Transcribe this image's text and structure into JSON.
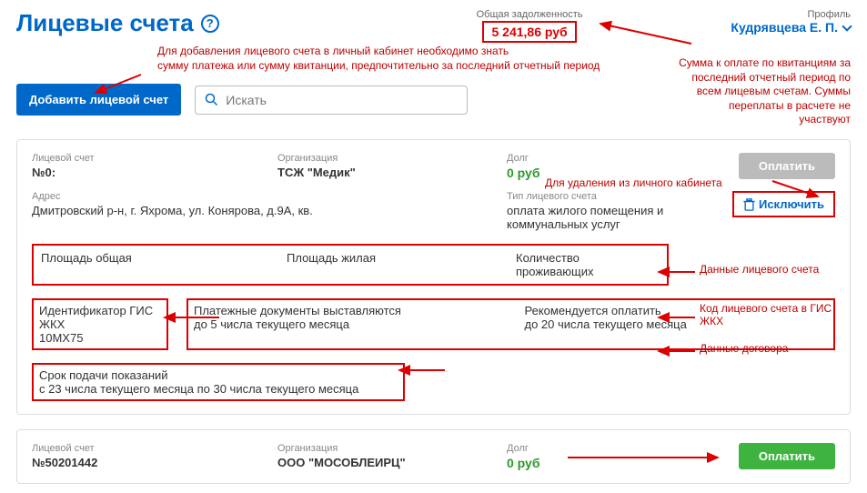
{
  "header": {
    "title": "Лицевые счета",
    "debt_label": "Общая задолженность",
    "debt_value": "5 241,86 руб",
    "profile_label": "Профиль",
    "profile_name": "Кудрявцева Е. П."
  },
  "hints": {
    "add_hint": "Для добавления лицевого счета в личный кабинет необходимо знать\nсумму платежа или сумму квитанции, предпочтительно за последний отчетный период",
    "debt_hint": "Сумма к оплате по квитанциям за последний отчетный период по всем лицевым счетам. Суммы переплаты в расчете не участвуют",
    "delete_hint": "Для удаления из личного кабинета",
    "data_hint": "Данные лицевого счета",
    "gis_hint": "Код лицевого счета в ГИС ЖКХ",
    "contract_hint": "Данные договора"
  },
  "actions": {
    "add_button": "Добавить лицевой счет",
    "search_placeholder": "Искать"
  },
  "account1": {
    "acc_label": "Лицевой счет",
    "acc_value": "№0:",
    "org_label": "Организация",
    "org_value": "ТСЖ \"Медик\"",
    "debt_label": "Долг",
    "debt_value": "0 руб",
    "pay_button": "Оплатить",
    "addr_label": "Адрес",
    "addr_value": "Дмитровский р-н, г. Яхрома, ул. Конярова, д.9А, кв.",
    "type_label": "Тип лицевого счета",
    "type_value": "оплата жилого помещения и коммунальных услуг",
    "exclude_button": "Исключить",
    "area_total_label": "Площадь общая",
    "area_live_label": "Площадь жилая",
    "residents_label": "Количество проживающих",
    "gis_label": "Идентификатор ГИС ЖКХ",
    "gis_value": "10МХ75",
    "docs_label": "Платежные документы выставляются",
    "docs_value": "до 5 числа текущего месяца",
    "rec_label": "Рекомендуется оплатить",
    "rec_value": "до 20 числа текущего месяца",
    "deadline_label": "Срок подачи показаний",
    "deadline_value": "с 23 числа текущего месяца по 30 числа текущего месяца"
  },
  "account2": {
    "acc_label": "Лицевой счет",
    "acc_value": "№50201442",
    "org_label": "Организация",
    "org_value": "ООО \"МОСОБЛЕИРЦ\"",
    "debt_label": "Долг",
    "debt_value": "0 руб",
    "pay_button": "Оплатить"
  }
}
